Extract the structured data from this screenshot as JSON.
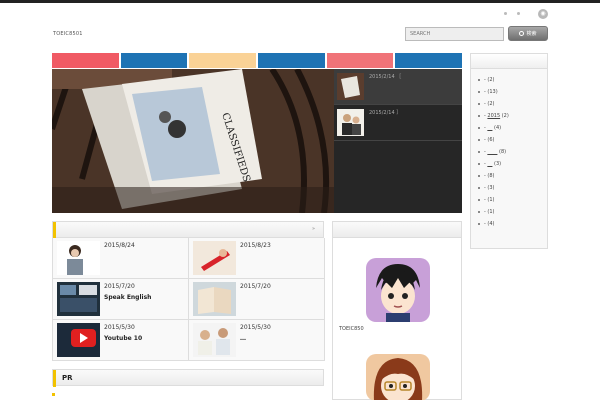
{
  "header": {
    "site_title": "TOEIC8501",
    "search_placeholder": "SEARCH",
    "search_button_label": "検索",
    "rss_icon": "rss-icon"
  },
  "nav": {
    "tabs": [
      {
        "color": "#f05a64"
      },
      {
        "color": "#1e73b4"
      },
      {
        "color": "#fad296"
      },
      {
        "color": "#1e73b4"
      },
      {
        "color": "#f07378"
      },
      {
        "color": "#1e73b4"
      }
    ]
  },
  "slider": {
    "image": "newspaper-classifieds-photo",
    "items": [
      {
        "date": "2015/2/14 ［",
        "thumb": "newspaper-thumb"
      },
      {
        "date": "2015/2/14 ］",
        "thumb": "business-people-thumb"
      }
    ]
  },
  "news": {
    "more_icon": "double-arrow-icon",
    "items": [
      {
        "date": "2015/8/24",
        "title": "",
        "thumb": "woman-on-phone"
      },
      {
        "date": "2015/8/23",
        "title": "",
        "thumb": "pencil-red"
      },
      {
        "date": "2015/7/20",
        "title": "Speak English",
        "thumb": "screen-windows"
      },
      {
        "date": "2015/7/20",
        "title": "",
        "thumb": "open-book"
      },
      {
        "date": "2015/5/30",
        "title": "Youtube 10",
        "thumb": "youtube-logo"
      },
      {
        "date": "2015/5/30",
        "title": "…",
        "thumb": "two-women"
      }
    ]
  },
  "pr": {
    "label": "PR"
  },
  "profile": {
    "caption": "TOEIC850"
  },
  "sidebar": {
    "items": [
      {
        "dash": "-",
        "link": "",
        "count": "(2)"
      },
      {
        "dash": "-",
        "link": "",
        "count": "(13)"
      },
      {
        "dash": "-",
        "link": "",
        "count": "(2)"
      },
      {
        "dash": "-",
        "link": "2015",
        "count": "(2)"
      },
      {
        "dash": "-",
        "link": "__",
        "count": "(4)"
      },
      {
        "dash": "-",
        "link": "",
        "count": "(6)"
      },
      {
        "dash": "-",
        "link": "____",
        "count": "(8)"
      },
      {
        "dash": "-",
        "link": "__",
        "count": "(3)"
      },
      {
        "dash": "-",
        "link": "",
        "count": "(8)"
      },
      {
        "dash": "-",
        "link": "",
        "count": "(3)"
      },
      {
        "dash": "-",
        "link": "",
        "count": "(1)"
      },
      {
        "dash": "-",
        "link": "",
        "count": "(1)"
      },
      {
        "dash": "-",
        "link": "",
        "count": "(4)"
      }
    ]
  }
}
